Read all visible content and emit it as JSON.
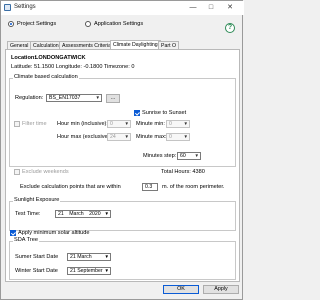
{
  "window": {
    "title": "Settings"
  },
  "mode": {
    "project_label": "Project Settings",
    "application_label": "Application Settings",
    "selected": "project"
  },
  "tabs": [
    {
      "label": "General"
    },
    {
      "label": "Calculation"
    },
    {
      "label": "Assessments Criteria"
    },
    {
      "label": "Climate Daylighting",
      "active": true
    },
    {
      "label": "Part O"
    }
  ],
  "location": {
    "prefix": "Location:",
    "name": "LONDONGATWICK",
    "coords": "Latitude: 51.1500  Longitude: -0.1800  Timezone: 0"
  },
  "climate_calc": {
    "title": "Climate based calculation",
    "regulation_label": "Regulation:",
    "regulation_value": "BS_EN17037",
    "regulation_more": "...",
    "sunrise_label": "Sunrise to Sunset",
    "sunrise_checked": true,
    "filter_label": "Filter time",
    "hour_min_label": "Hour min (inclusive):",
    "hour_min_value": "0",
    "hour_max_label": "Hour max (exclusive):",
    "hour_max_value": "24",
    "minute_min_label": "Minute min:",
    "minute_min_value": "0",
    "minute_max_label": "Minute max:",
    "minute_max_value": "0",
    "minutes_step_label": "Minutes step:",
    "minutes_step_value": "60",
    "exclude_weekends_label": "Exclude weekends",
    "total_hours": "Total Hours: 4380",
    "exclude_points_label": "Exclude calculation points that are within",
    "exclude_points_value": "0.3",
    "exclude_points_suffix": "m. of the room perimeter."
  },
  "sunlight": {
    "title": "Sunlight Exposure",
    "test_time_label": "Test Time:",
    "test_time_day": "21",
    "test_time_month": "March",
    "test_time_year": "2020",
    "min_altitude_label": "Apply minimum solar altitude",
    "min_altitude_checked": true
  },
  "sda": {
    "title": "SDA Tree",
    "summer_label": "Sumer Start Date",
    "summer_value": "21    March",
    "winter_label": "Winter Start Date",
    "winter_value": "21 September"
  },
  "footer": {
    "ok": "OK",
    "apply": "Apply"
  },
  "colors": {
    "accent": "#0a5bd5",
    "help": "#2e8b57"
  }
}
